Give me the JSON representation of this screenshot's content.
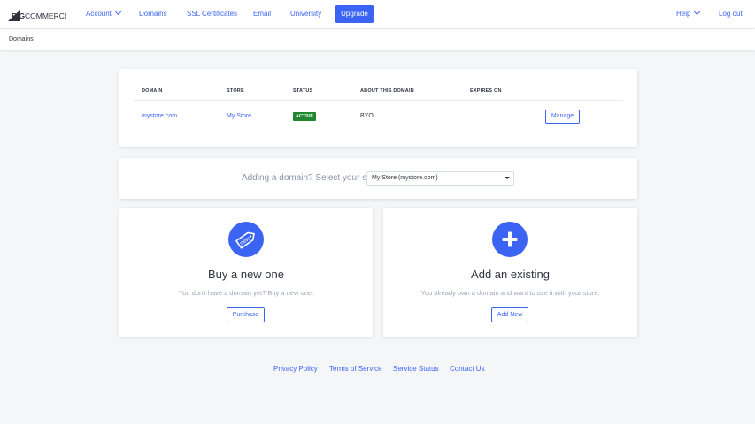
{
  "nav": {
    "logo_prefix": "BIG",
    "logo_suffix": "COMMERCE",
    "account": "Account",
    "domains": "Domains",
    "ssl": "SSL Certificates",
    "email": "Email",
    "university": "University",
    "upgrade": "Upgrade",
    "help": "Help",
    "logout": "Log out"
  },
  "breadcrumb": "Domains",
  "domains_table": {
    "headers": [
      "DOMAIN",
      "STORE",
      "STATUS",
      "ABOUT THIS DOMAIN",
      "EXPIRES ON"
    ],
    "rows": [
      {
        "domain": "mystore.com",
        "store": "My Store",
        "status": "ACTIVE",
        "about": "BYO",
        "expires": "",
        "action": "Manage"
      }
    ]
  },
  "store_select": {
    "label": "Adding a domain? Select your store",
    "value": "My Store (mystore.com)"
  },
  "buy_option": {
    "icon": "new-tag-icon",
    "icon_text": "new",
    "title": "Buy a new one",
    "subtitle": "You don't have a domain yet? Buy a new one.",
    "button": "Purchase"
  },
  "existing_option": {
    "icon": "plus-icon",
    "title": "Add an existing",
    "subtitle": "You already own a domain and want to use it with your store.",
    "button": "Add New"
  },
  "footer": {
    "privacy": "Privacy Policy",
    "terms": "Terms of Service",
    "status": "Service Status",
    "contact": "Contact Us"
  },
  "colors": {
    "accent": "#3c64f4",
    "active_badge": "#208831",
    "background": "#f5f6f8"
  }
}
